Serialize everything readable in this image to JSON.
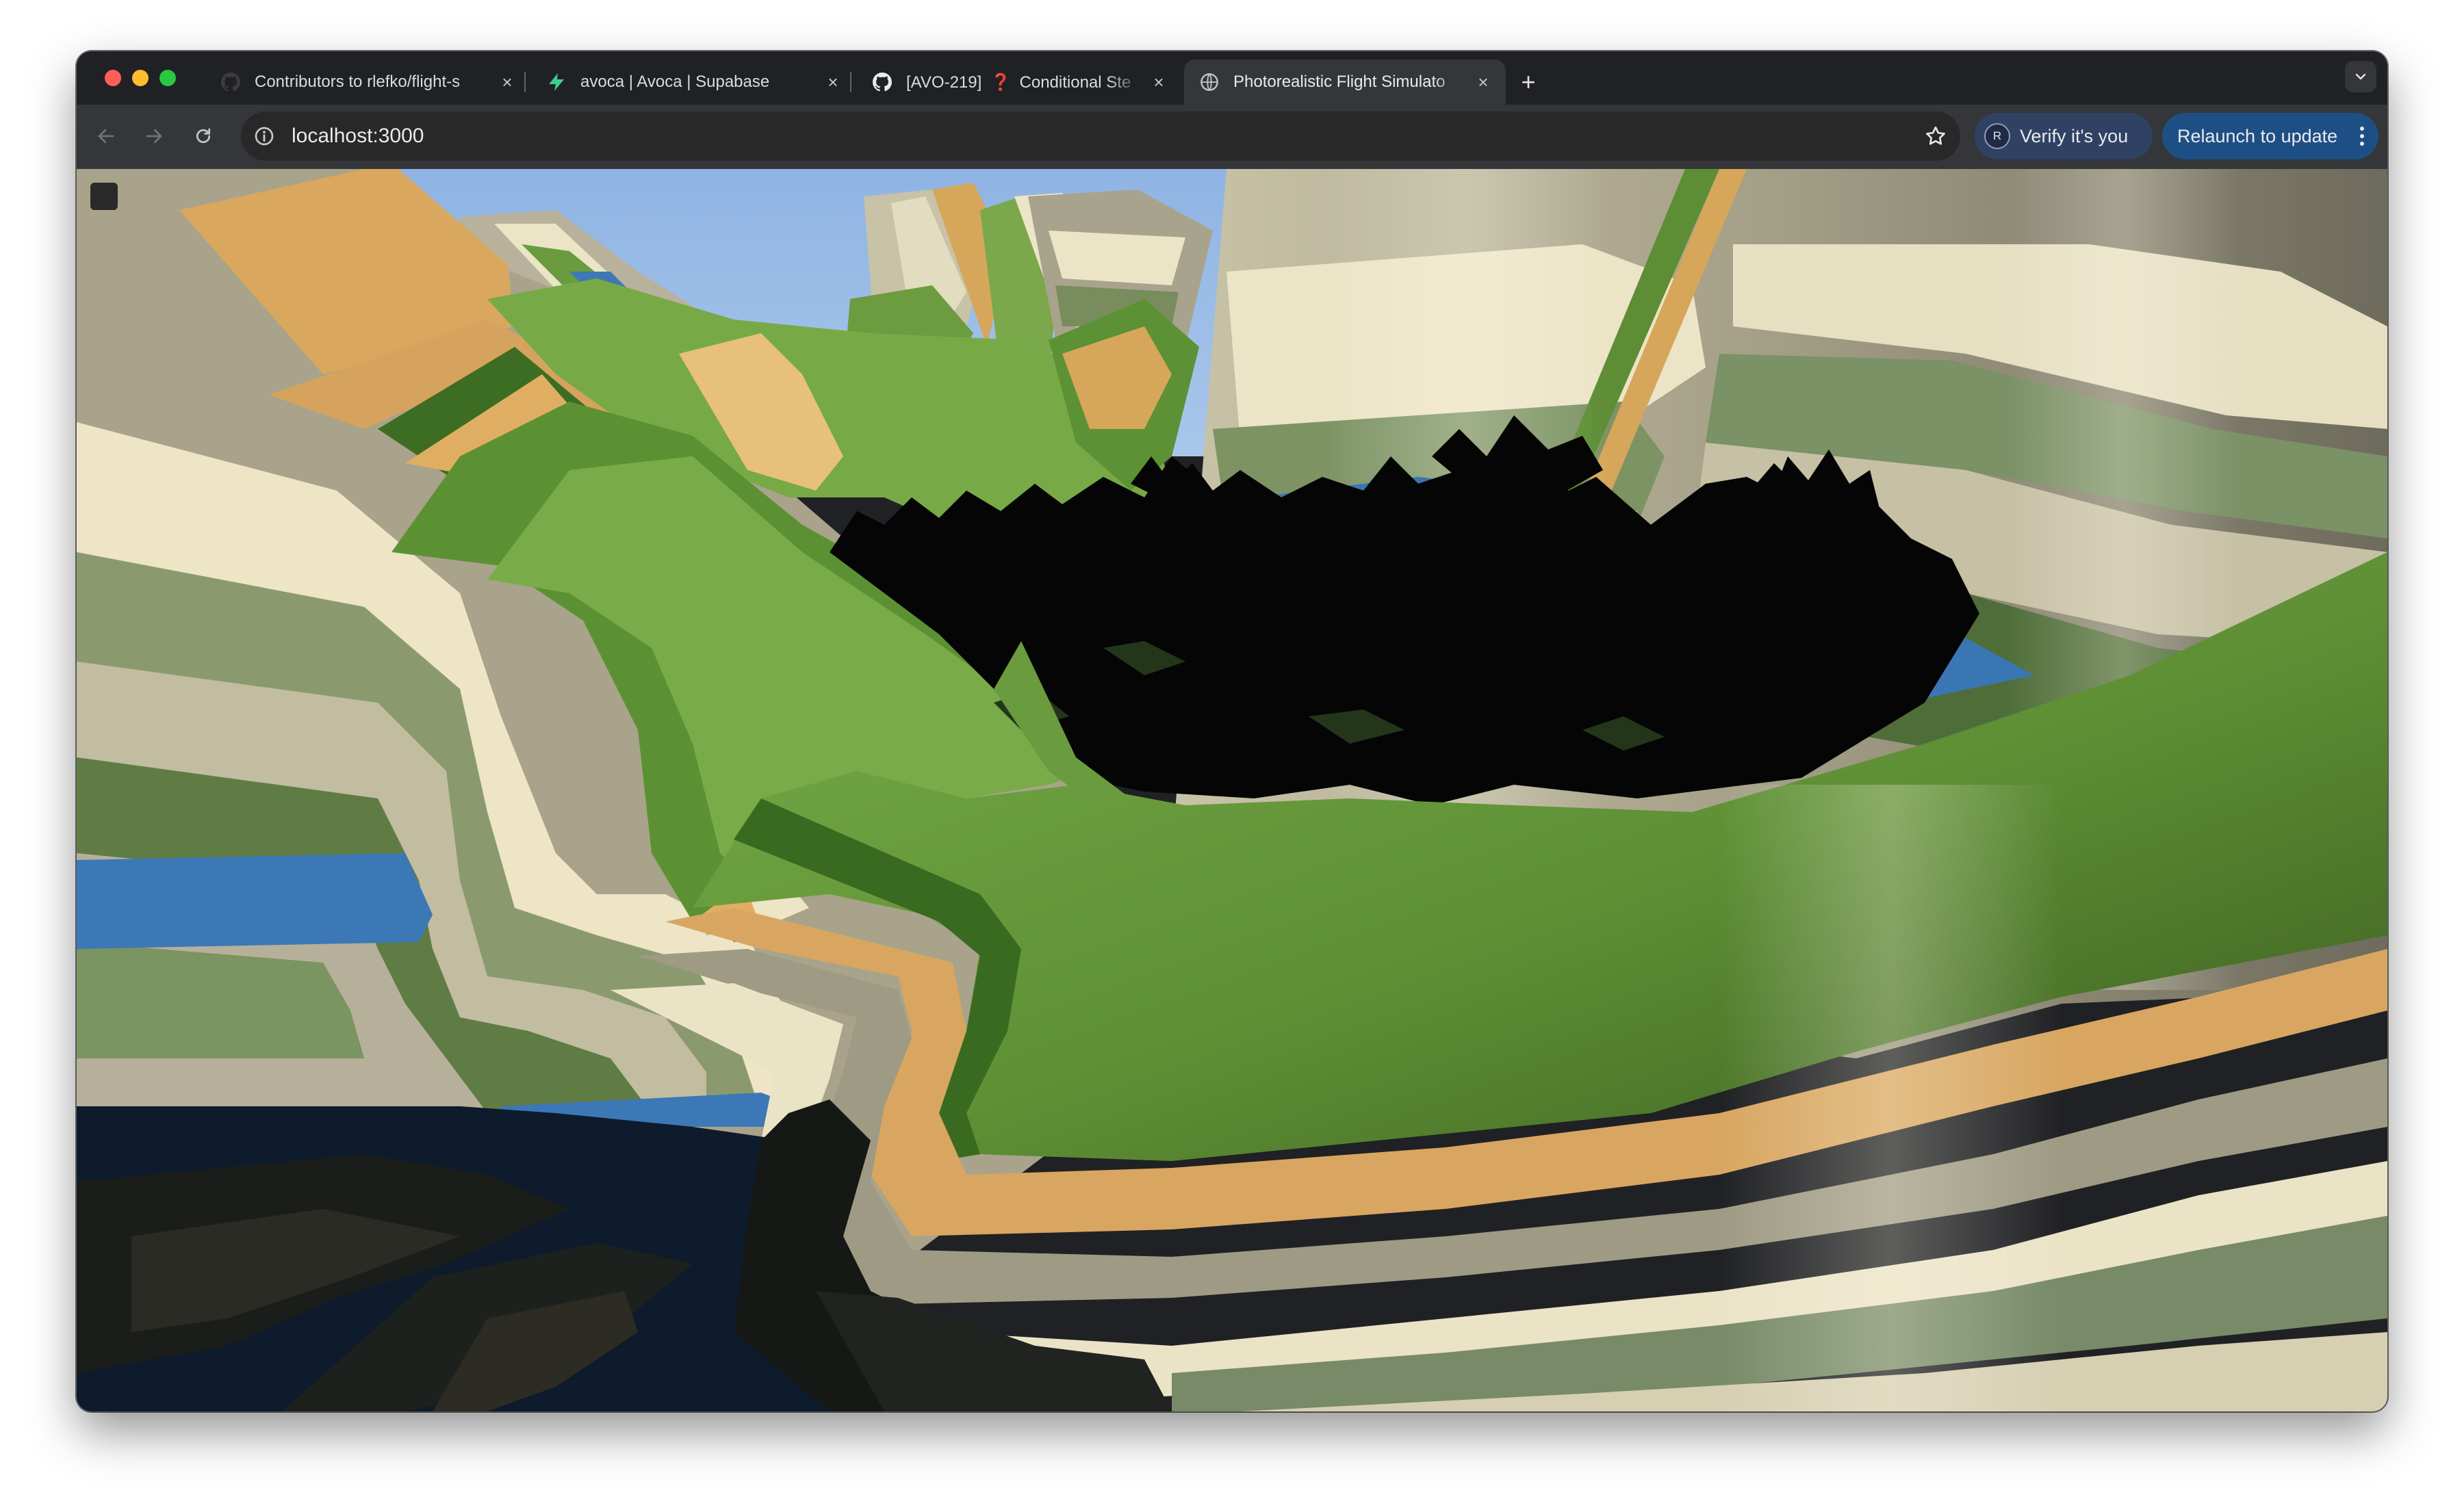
{
  "window": {
    "controls": {
      "close": "#ff5f57",
      "minimize": "#febc2e",
      "maximize": "#28c840"
    }
  },
  "tabs": [
    {
      "title": "Contributors to rlefko/flight-s",
      "icon": "github-icon",
      "active": false
    },
    {
      "title": "avoca | Avoca | Supabase",
      "icon": "supabase-bolt-icon",
      "active": false
    },
    {
      "title_prefix": "[AVO-219]",
      "title_badge": "❓",
      "title_suffix": "Conditional Ste",
      "icon": "github-icon",
      "active": false
    },
    {
      "title": "Photorealistic Flight Simulato",
      "icon": "globe-icon",
      "active": true
    }
  ],
  "new_tab_glyph": "+",
  "toolbar": {
    "url": "localhost:3000",
    "verify_label": "Verify it's you",
    "verify_avatar_letter": "R",
    "relaunch_label": "Relaunch to update"
  },
  "scene": {
    "description_free": true,
    "palette": {
      "sky": "#8db4e2",
      "grass": "#6ea343",
      "dark_grass": "#3f6f21",
      "sand": "#d9a962",
      "cream": "#ebe3c4",
      "rock_grey": "#a5a08a",
      "water": "#3c78b5",
      "shadow": "#0c1a2a",
      "trees": "#050505"
    }
  }
}
